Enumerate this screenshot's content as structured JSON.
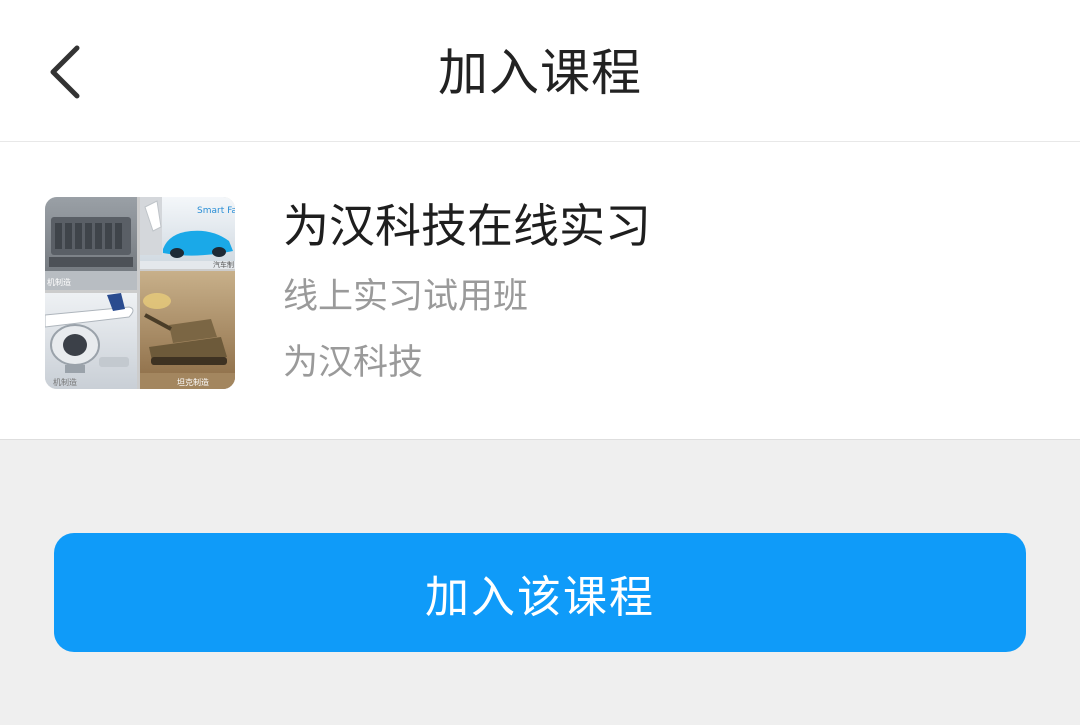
{
  "header": {
    "back_icon": "chevron-left-icon",
    "title": "加入课程"
  },
  "course": {
    "title": "为汉科技在线实习",
    "class_name": "线上实习试用班",
    "organization": "为汉科技",
    "thumbnail_captions": {
      "engine": "机制造",
      "car_brand": "Smart Fac",
      "car": "汽车制",
      "plane": "机制造",
      "tank": "坦克制造"
    }
  },
  "actions": {
    "join_label": "加入该课程"
  },
  "colors": {
    "accent": "#0f9bf9",
    "background": "#efefef",
    "surface": "#ffffff",
    "title_text": "#222222",
    "secondary_text": "#9a9a9a"
  }
}
